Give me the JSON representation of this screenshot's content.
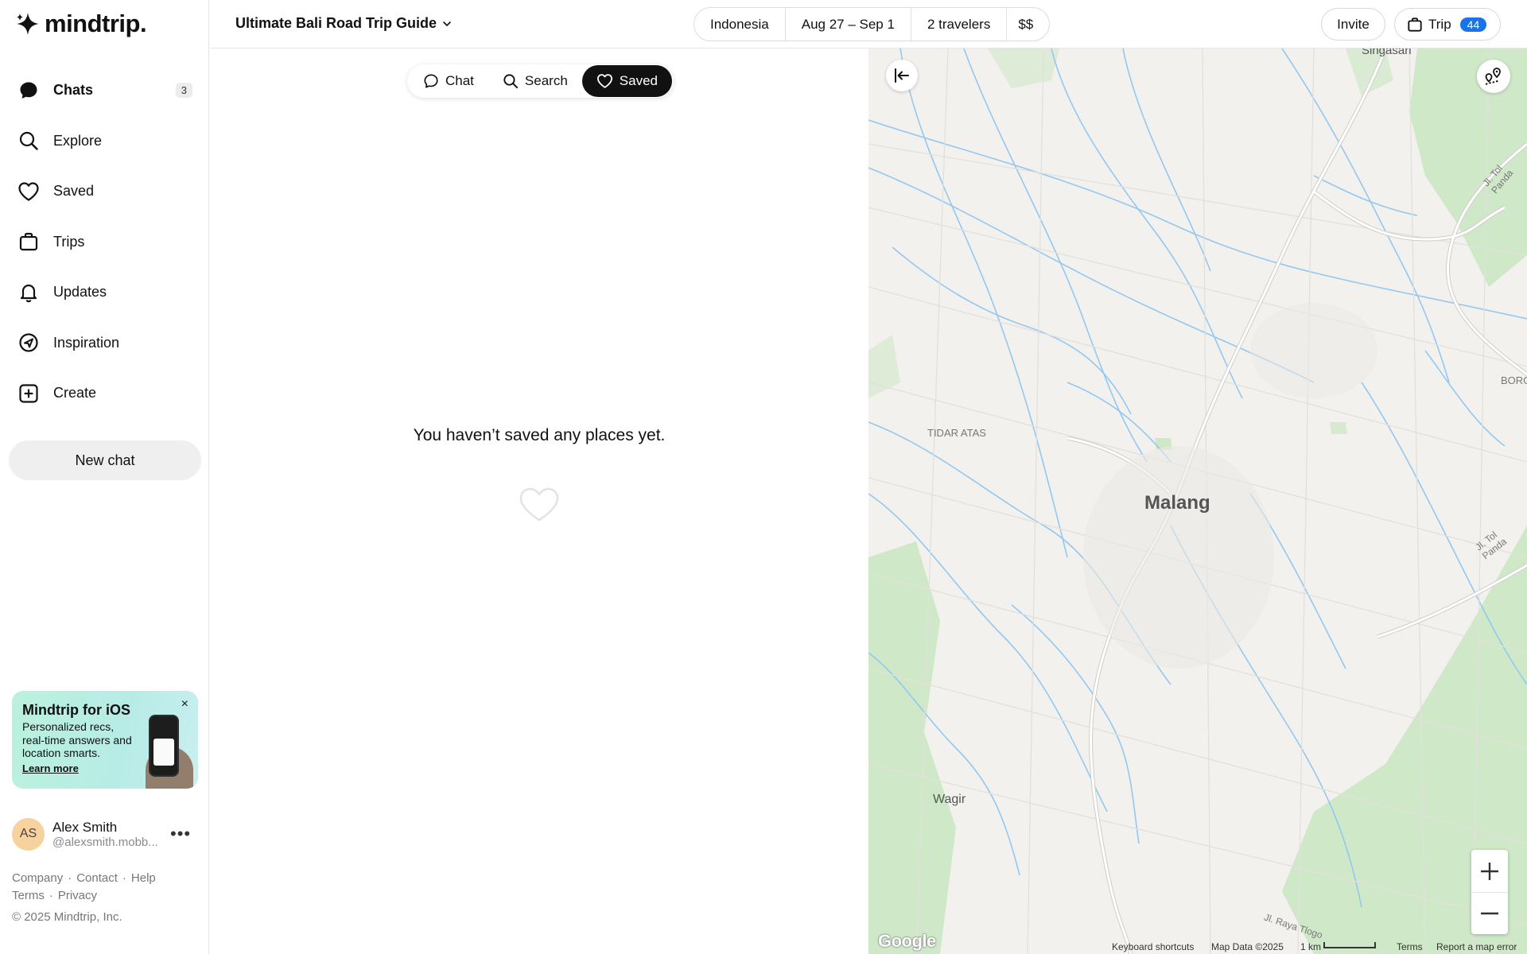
{
  "app": {
    "brand": "mindtrip."
  },
  "sidebar": {
    "items": [
      {
        "label": "Chats",
        "icon": "chat-bubble-icon",
        "badge": "3"
      },
      {
        "label": "Explore",
        "icon": "search-icon"
      },
      {
        "label": "Saved",
        "icon": "heart-icon"
      },
      {
        "label": "Trips",
        "icon": "suitcase-icon"
      },
      {
        "label": "Updates",
        "icon": "bell-icon"
      },
      {
        "label": "Inspiration",
        "icon": "compass-icon"
      },
      {
        "label": "Create",
        "icon": "plus-square-icon"
      }
    ],
    "new_chat": "New chat",
    "promo": {
      "title": "Mindtrip for iOS",
      "description": "Personalized recs, real-time answers and location smarts.",
      "link": "Learn more",
      "close": "×"
    },
    "user": {
      "initials": "AS",
      "name": "Alex Smith",
      "handle": "@alexsmith.mobb..."
    },
    "footer": {
      "company": "Company",
      "contact": "Contact",
      "help": "Help",
      "terms": "Terms",
      "privacy": "Privacy",
      "copyright": "© 2025 Mindtrip, Inc."
    }
  },
  "header": {
    "trip_title": "Ultimate Bali Road Trip Guide",
    "filters": {
      "location": "Indonesia",
      "dates": "Aug 27 – Sep 1",
      "travelers": "2 travelers",
      "budget": "$$"
    },
    "invite": "Invite",
    "trip": "Trip",
    "trip_count": "44"
  },
  "main": {
    "tabs": [
      {
        "label": "Chat",
        "icon": "chat-bubble-icon",
        "active": false
      },
      {
        "label": "Search",
        "icon": "search-icon",
        "active": false
      },
      {
        "label": "Saved",
        "icon": "heart-icon",
        "active": true
      }
    ],
    "empty_message": "You haven’t saved any places yet."
  },
  "map": {
    "labels": {
      "singasari": "Singasari",
      "tidar_atas": "TIDAR ATAS",
      "malang": "Malang",
      "wagir": "Wagir",
      "borg": "BORG",
      "jl_toi_panda_1": "Jl. Tol Panda",
      "jl_toi_panda_2": "Jl. Tol Panda",
      "jl_raya_tlogo": "Jl. Raya Tlogo"
    },
    "attribution": {
      "google": "Google",
      "shortcuts": "Keyboard shortcuts",
      "map_data": "Map Data ©2025",
      "scale": "1 km",
      "terms": "Terms",
      "report": "Report a map error"
    },
    "colors": {
      "land": "#f3f1ee",
      "water": "#8cc4f0",
      "park": "#c8e6c2",
      "road": "#ffffff"
    }
  }
}
